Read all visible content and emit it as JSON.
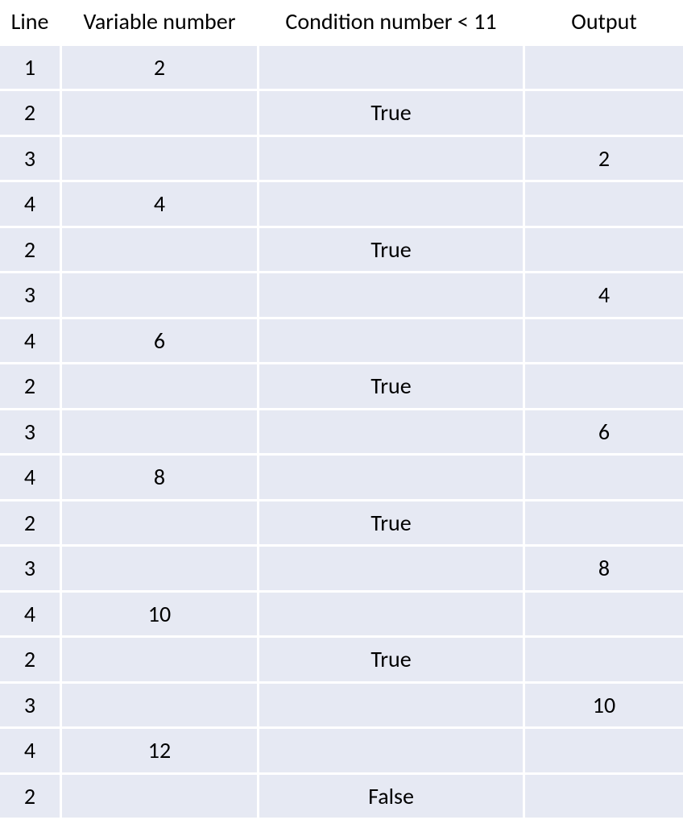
{
  "headers": {
    "line": "Line",
    "variable": "Variable number",
    "condition": "Condition number < 11",
    "output": "Output"
  },
  "rows": [
    {
      "line": "1",
      "variable": "2",
      "condition": "",
      "output": ""
    },
    {
      "line": "2",
      "variable": "",
      "condition": "True",
      "output": ""
    },
    {
      "line": "3",
      "variable": "",
      "condition": "",
      "output": "2"
    },
    {
      "line": "4",
      "variable": "4",
      "condition": "",
      "output": ""
    },
    {
      "line": "2",
      "variable": "",
      "condition": "True",
      "output": ""
    },
    {
      "line": "3",
      "variable": "",
      "condition": "",
      "output": "4"
    },
    {
      "line": "4",
      "variable": "6",
      "condition": "",
      "output": ""
    },
    {
      "line": "2",
      "variable": "",
      "condition": "True",
      "output": ""
    },
    {
      "line": "3",
      "variable": "",
      "condition": "",
      "output": "6"
    },
    {
      "line": "4",
      "variable": "8",
      "condition": "",
      "output": ""
    },
    {
      "line": "2",
      "variable": "",
      "condition": "True",
      "output": ""
    },
    {
      "line": "3",
      "variable": "",
      "condition": "",
      "output": "8"
    },
    {
      "line": "4",
      "variable": "10",
      "condition": "",
      "output": ""
    },
    {
      "line": "2",
      "variable": "",
      "condition": "True",
      "output": ""
    },
    {
      "line": "3",
      "variable": "",
      "condition": "",
      "output": "10"
    },
    {
      "line": "4",
      "variable": "12",
      "condition": "",
      "output": ""
    },
    {
      "line": "2",
      "variable": "",
      "condition": "False",
      "output": ""
    }
  ]
}
